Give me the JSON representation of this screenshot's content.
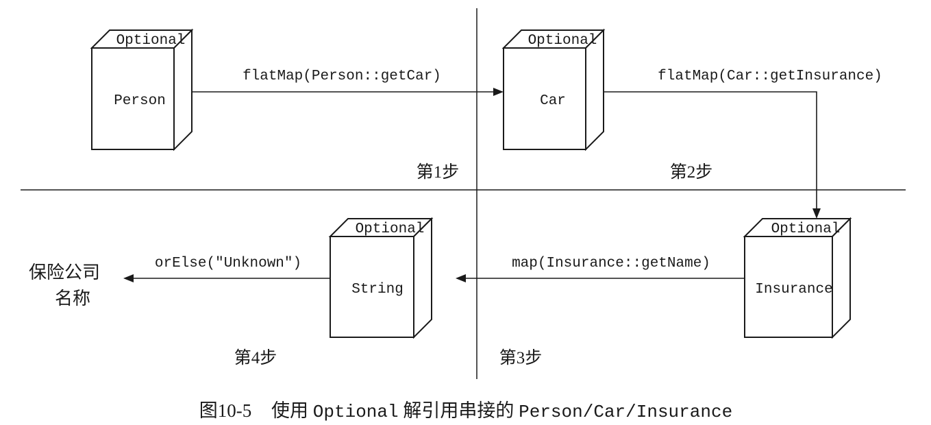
{
  "diagram": {
    "boxes": [
      {
        "wrapper": "Optional",
        "content": "Person"
      },
      {
        "wrapper": "Optional",
        "content": "Car"
      },
      {
        "wrapper": "Optional",
        "content": "Insurance"
      },
      {
        "wrapper": "Optional",
        "content": "String"
      }
    ],
    "arrows": [
      {
        "label": "flatMap(Person::getCar)"
      },
      {
        "label": "flatMap(Car::getInsurance)"
      },
      {
        "label": "map(Insurance::getName)"
      },
      {
        "label": "orElse(\"Unknown\")"
      }
    ],
    "steps": [
      "第1步",
      "第2步",
      "第3步",
      "第4步"
    ],
    "result": {
      "line1": "保险公司",
      "line2": "名称"
    }
  },
  "caption": {
    "figure_number": "图10-5",
    "prefix": "使用",
    "code_1": "Optional",
    "middle": "解引用串接的",
    "code_2": "Person/Car/Insurance"
  },
  "colors": {
    "ink": "#1a1a1a",
    "background": "#ffffff"
  }
}
